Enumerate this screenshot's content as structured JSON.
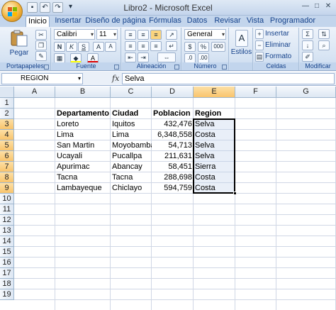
{
  "window": {
    "title": "Libro2 - Microsoft Excel"
  },
  "tabs": [
    "Inicio",
    "Insertar",
    "Diseño de página",
    "Fórmulas",
    "Datos",
    "Revisar",
    "Vista",
    "Programador"
  ],
  "ribbon": {
    "clipboard": {
      "label": "Portapapeles",
      "paste": "Pegar"
    },
    "font": {
      "label": "Fuente",
      "name": "Calibri",
      "size": "11",
      "bold": "N",
      "italic": "K",
      "underline": "S"
    },
    "alignment": {
      "label": "Alineación"
    },
    "number": {
      "label": "Número",
      "format": "General",
      "currency": "$",
      "percent": "%",
      "thousands": "000"
    },
    "styles": {
      "label": "",
      "styles_button": "Estilos"
    },
    "cells": {
      "label": "Celdas",
      "insert": "Insertar",
      "delete": "Eliminar",
      "format": "Formato"
    },
    "editing": {
      "label": "Modificar",
      "sum": "Σ"
    }
  },
  "formula_bar": {
    "name_box": "REGION",
    "fx": "fx",
    "value": "Selva"
  },
  "columns": [
    "A",
    "B",
    "C",
    "D",
    "E",
    "F",
    "G"
  ],
  "rows": [
    "1",
    "2",
    "3",
    "4",
    "5",
    "6",
    "7",
    "8",
    "9",
    "10",
    "11",
    "12",
    "13",
    "14",
    "15",
    "16",
    "17",
    "18",
    "19"
  ],
  "table": {
    "headers": [
      "Departamento",
      "Ciudad",
      "Poblacion",
      "Region"
    ],
    "rows": [
      [
        "Loreto",
        "Iquitos",
        "432,476",
        "Selva"
      ],
      [
        "Lima",
        "Lima",
        "6,348,558",
        "Costa"
      ],
      [
        "San Martin",
        "Moyobamba",
        "54,713",
        "Selva"
      ],
      [
        "Ucayali",
        "Pucallpa",
        "211,631",
        "Selva"
      ],
      [
        "Apurimac",
        "Abancay",
        "58,451",
        "Sierra"
      ],
      [
        "Tacna",
        "Tacna",
        "288,698",
        "Costa"
      ],
      [
        "Lambayeque",
        "Chiclayo",
        "594,759",
        "Costa"
      ]
    ]
  },
  "selection": {
    "column": "E",
    "first_row": 3,
    "last_row": 9
  }
}
